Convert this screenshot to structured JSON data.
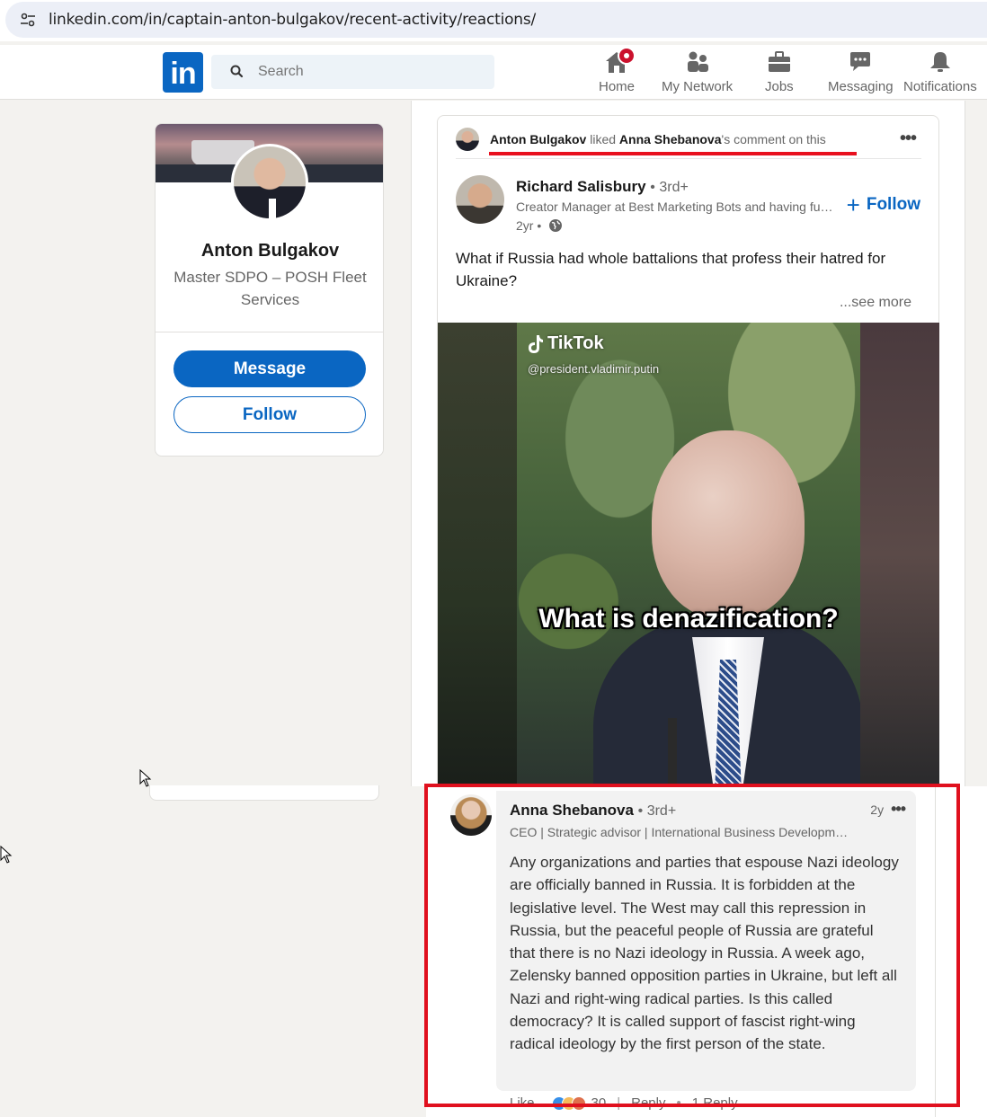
{
  "browser": {
    "url": "linkedin.com/in/captain-anton-bulgakov/recent-activity/reactions/"
  },
  "nav": {
    "logo_text": "in",
    "search_placeholder": "Search",
    "items": [
      {
        "label": "Home",
        "icon": "home-icon"
      },
      {
        "label": "My Network",
        "icon": "network-icon"
      },
      {
        "label": "Jobs",
        "icon": "briefcase-icon"
      },
      {
        "label": "Messaging",
        "icon": "messaging-icon"
      },
      {
        "label": "Notifications",
        "icon": "bell-icon"
      }
    ]
  },
  "profile": {
    "name": "Anton Bulgakov",
    "headline": "Master SDPO – POSH Fleet Services",
    "message_label": "Message",
    "follow_label": "Follow"
  },
  "activity": {
    "actor": "Anton Bulgakov",
    "verb": "liked",
    "target": "Anna Shebanova",
    "suffix": "'s comment on this"
  },
  "post": {
    "author": "Richard Salisbury",
    "degree": "• 3rd+",
    "title": "Creator Manager at Best Marketing Bots and having fun with automation",
    "time": "2yr •",
    "follow_label": "Follow",
    "text": "What if Russia had whole battalions that profess their hatred for Ukraine?",
    "see_more": "...see more",
    "video": {
      "tiktok_label": "TikTok",
      "handle": "@president.vladimir.putin",
      "caption": "What is denazification?"
    }
  },
  "comment": {
    "author": "Anna Shebanova",
    "degree": "• 3rd+",
    "time": "2y",
    "title": "CEO | Strategic advisor | International Business Development",
    "text": "Any organizations and parties that espouse Nazi ideology are officially banned in Russia. It is forbidden at the legislative level. The West may call this repression in Russia, but the peaceful people of Russia are grateful that there is no Nazi ideology in Russia. A week ago, Zelensky banned opposition parties in Ukraine, but left all Nazi and right-wing radical parties. Is this called democracy? It is called support of fascist right-wing radical ideology by the first person of the state.",
    "like_label": "Like",
    "reaction_count": "30",
    "reply_label": "Reply",
    "replies_label": "1 Reply"
  },
  "colors": {
    "brand": "#0a66c2",
    "highlight_red": "#e0101e",
    "page_bg": "#f3f2ef"
  }
}
